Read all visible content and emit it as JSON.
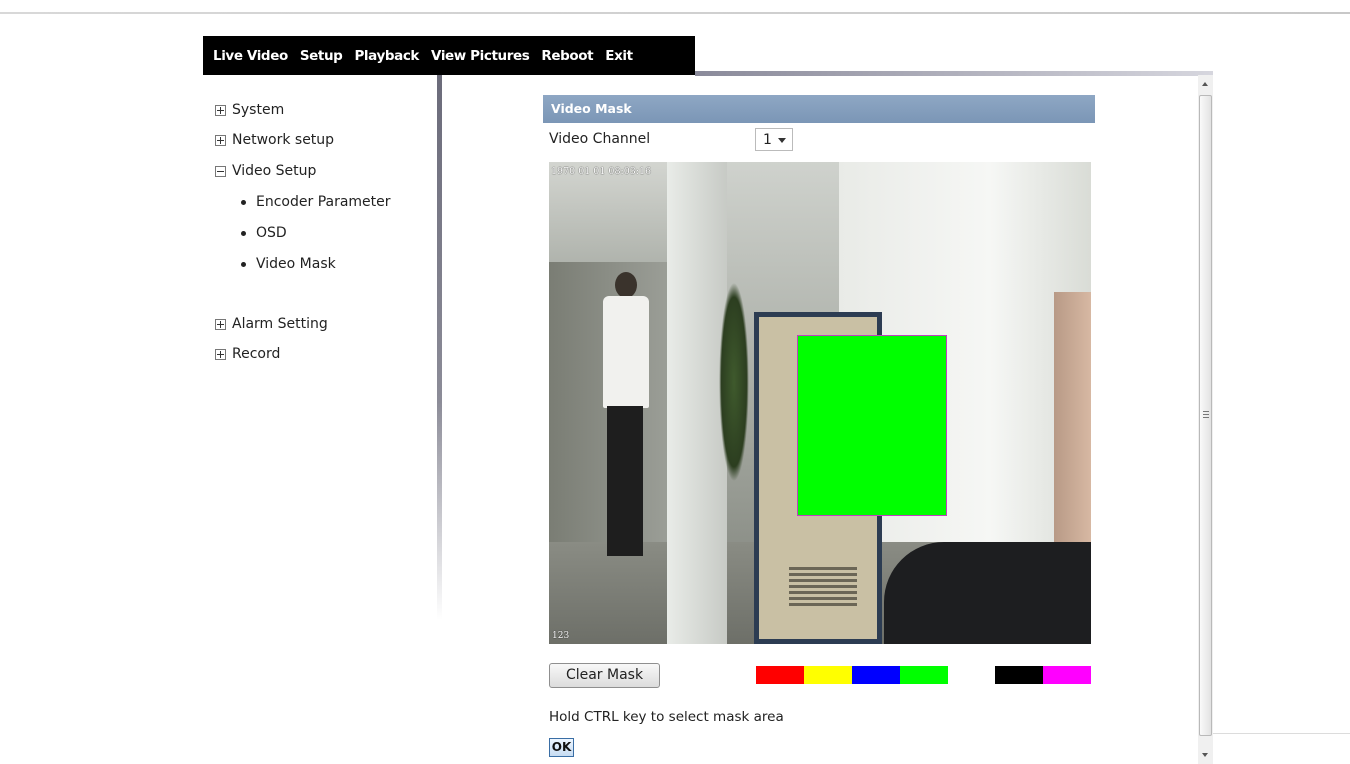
{
  "nav": {
    "items": [
      "Live Video",
      "Setup",
      "Playback",
      "View Pictures",
      "Reboot",
      "Exit"
    ]
  },
  "sidebar": {
    "system": "System",
    "network": "Network setup",
    "video_setup": "Video Setup",
    "sub_items": [
      "Encoder Parameter",
      "OSD",
      "Video Mask"
    ],
    "alarm": "Alarm Setting",
    "record": "Record"
  },
  "main": {
    "section_title": "Video Mask",
    "channel_label": "Video Channel",
    "channel_value": "1",
    "osd_timestamp": "1970 01 01 08:03:16",
    "osd_channel_name": "123",
    "clear_button": "Clear Mask",
    "mask_colors": [
      "#ff0000",
      "#ffff00",
      "#0000ff",
      "#00ff00",
      "#000000",
      "#ff00ff"
    ],
    "active_mask_color": "#00ff00",
    "hint": "Hold CTRL key to select mask area",
    "ok_button": "OK"
  }
}
